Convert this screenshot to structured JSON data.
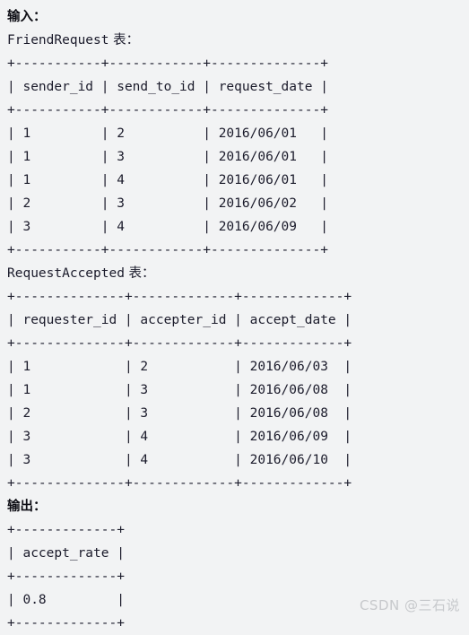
{
  "sections": {
    "input_label": "输入：",
    "output_label": "输出："
  },
  "friend_request": {
    "title_name": "FriendRequest",
    "title_suffix": " 表：",
    "separator": "+-----------+------------+--------------+",
    "header_row": "| sender_id | send_to_id | request_date |",
    "columns": [
      "sender_id",
      "send_to_id",
      "request_date"
    ],
    "rows": [
      {
        "sender_id": "1",
        "send_to_id": "2",
        "request_date": "2016/06/01",
        "text": "| 1         | 2          | 2016/06/01   |"
      },
      {
        "sender_id": "1",
        "send_to_id": "3",
        "request_date": "2016/06/01",
        "text": "| 1         | 3          | 2016/06/01   |"
      },
      {
        "sender_id": "1",
        "send_to_id": "4",
        "request_date": "2016/06/01",
        "text": "| 1         | 4          | 2016/06/01   |"
      },
      {
        "sender_id": "2",
        "send_to_id": "3",
        "request_date": "2016/06/02",
        "text": "| 2         | 3          | 2016/06/02   |"
      },
      {
        "sender_id": "3",
        "send_to_id": "4",
        "request_date": "2016/06/09",
        "text": "| 3         | 4          | 2016/06/09   |"
      }
    ]
  },
  "request_accepted": {
    "title_name": "RequestAccepted",
    "title_suffix": " 表：",
    "separator": "+--------------+-------------+-------------+",
    "header_row": "| requester_id | accepter_id | accept_date |",
    "columns": [
      "requester_id",
      "accepter_id",
      "accept_date"
    ],
    "rows": [
      {
        "requester_id": "1",
        "accepter_id": "2",
        "accept_date": "2016/06/03",
        "text": "| 1            | 2           | 2016/06/03  |"
      },
      {
        "requester_id": "1",
        "accepter_id": "3",
        "accept_date": "2016/06/08",
        "text": "| 1            | 3           | 2016/06/08  |"
      },
      {
        "requester_id": "2",
        "accepter_id": "3",
        "accept_date": "2016/06/08",
        "text": "| 2            | 3           | 2016/06/08  |"
      },
      {
        "requester_id": "3",
        "accepter_id": "4",
        "accept_date": "2016/06/09",
        "text": "| 3            | 4           | 2016/06/09  |"
      },
      {
        "requester_id": "3",
        "accepter_id": "4",
        "accept_date": "2016/06/10",
        "text": "| 3            | 4           | 2016/06/10  |"
      }
    ]
  },
  "output_table": {
    "separator": "+-------------+",
    "header_row": "| accept_rate |",
    "columns": [
      "accept_rate"
    ],
    "rows": [
      {
        "accept_rate": "0.8",
        "text": "| 0.8         |"
      }
    ]
  },
  "watermark": {
    "text": "CSDN @三石说"
  }
}
